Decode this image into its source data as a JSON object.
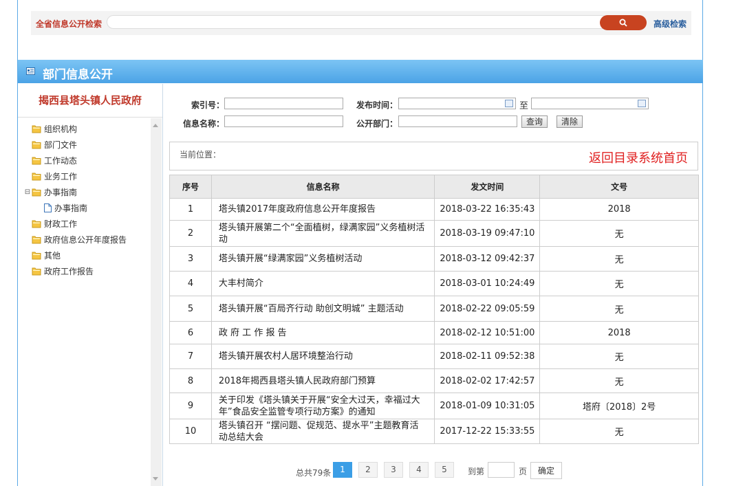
{
  "search": {
    "label": "全省信息公开检索",
    "placeholder": "",
    "advanced": "高级检索"
  },
  "header": {
    "title": "部门信息公开"
  },
  "sidebar": {
    "org_name": "揭西县塔头镇人民政府",
    "items": [
      {
        "label": "组织机构",
        "type": "folder"
      },
      {
        "label": "部门文件",
        "type": "folder"
      },
      {
        "label": "工作动态",
        "type": "folder"
      },
      {
        "label": "业务工作",
        "type": "folder"
      },
      {
        "label": "办事指南",
        "type": "folder",
        "expanded": true
      },
      {
        "label": "办事指南",
        "type": "doc",
        "child": true
      },
      {
        "label": "财政工作",
        "type": "folder"
      },
      {
        "label": "政府信息公开年度报告",
        "type": "folder"
      },
      {
        "label": "其他",
        "type": "folder"
      },
      {
        "label": "政府工作报告",
        "type": "folder"
      }
    ]
  },
  "filter": {
    "index_label": "索引号：",
    "date_label": "发布时间：",
    "to_label": "至",
    "name_label": "信息名称：",
    "dept_label": "公开部门：",
    "query_btn": "查询",
    "clear_btn": "清除"
  },
  "position": {
    "label": "当前位置：",
    "back": "返回目录系统首页"
  },
  "table": {
    "headers": [
      "序号",
      "信息名称",
      "发文时间",
      "文号"
    ],
    "rows": [
      [
        "1",
        "塔头镇2017年度政府信息公开年度报告",
        "2018-03-22 16:35:43",
        "2018"
      ],
      [
        "2",
        "塔头镇开展第二个“全面植树，绿满家园”义务植树活动",
        "2018-03-19 09:47:10",
        "无"
      ],
      [
        "3",
        "塔头镇开展“绿满家园”义务植树活动",
        "2018-03-12 09:42:37",
        "无"
      ],
      [
        "4",
        "大丰村简介",
        "2018-03-01 10:24:49",
        "无"
      ],
      [
        "5",
        "塔头镇开展“百局齐行动  助创文明城” 主题活动",
        "2018-02-22 09:05:59",
        "无"
      ],
      [
        "6",
        "政 府 工 作 报 告",
        "2018-02-12 10:51:00",
        "2018"
      ],
      [
        "7",
        "塔头镇开展农村人居环境整治行动",
        "2018-02-11 09:52:38",
        "无"
      ],
      [
        "8",
        "2018年揭西县塔头镇人民政府部门预算",
        "2018-02-02 17:42:57",
        "无"
      ],
      [
        "9",
        "关于印发《塔头镇关于开展“安全大过天，幸福过大年”食品安全监管专项行动方案》的通知",
        "2018-01-09 10:31:05",
        "塔府〔2018〕2号"
      ],
      [
        "10",
        "塔头镇召开 “摆问题、促规范、提水平”主题教育活动总结大会",
        "2017-12-22 15:33:55",
        "无"
      ]
    ]
  },
  "pager": {
    "total": "总共79条",
    "pages": [
      "1",
      "2",
      "3",
      "4",
      "5"
    ],
    "active": "1",
    "goto_label": "到第",
    "page_unit": "页",
    "confirm": "确定"
  },
  "colors": {
    "accent": "#4ba3e6",
    "brand_red": "#c0392b",
    "search_btn": "#c84320"
  }
}
